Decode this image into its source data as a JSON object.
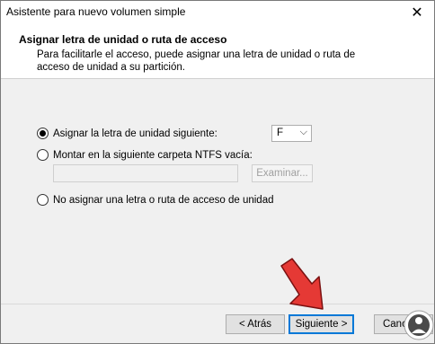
{
  "window": {
    "title": "Asistente para nuevo volumen simple",
    "close_glyph": "✕"
  },
  "header": {
    "title": "Asignar letra de unidad o ruta de acceso",
    "description": "Para facilitarle el acceso, puede asignar una letra de unidad o ruta de acceso de unidad a su partición."
  },
  "options": {
    "assign_letter": {
      "label": "Asignar la letra de unidad siguiente:",
      "checked": true
    },
    "mount_folder": {
      "label": "Montar en la siguiente carpeta NTFS vacía:",
      "checked": false
    },
    "no_assign": {
      "label": "No asignar una letra o ruta de acceso de unidad",
      "checked": false
    }
  },
  "drive_select": {
    "value": "F",
    "chevron": "⌵"
  },
  "path_input": {
    "value": ""
  },
  "browse_button": {
    "label": "Examinar..."
  },
  "buttons": {
    "back": "< Atrás",
    "next": "Siguiente >",
    "cancel": "Cancelar"
  },
  "colors": {
    "arrow": "#e53935",
    "focus": "#0078d7"
  },
  "icons": [
    "close-icon",
    "chevron-down-icon",
    "red-arrow-pointer",
    "logo-icon"
  ]
}
